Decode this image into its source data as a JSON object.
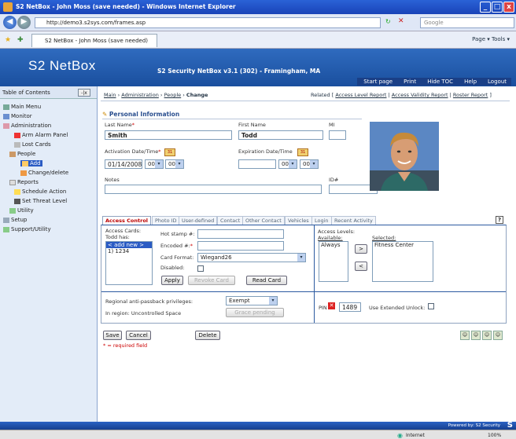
{
  "window": {
    "title": "S2 NetBox - John Moss (save needed) - Windows Internet Explorer",
    "url": "http://demo3.s2sys.com/frames.asp",
    "search_placeholder": "Google",
    "tab_title": "S2 NetBox - John Moss (save needed)",
    "ie_tools": "Page ▾  Tools ▾"
  },
  "app": {
    "logo": "S2 NetBox",
    "title": "S2 Security NetBox v3.1 (302) - Framingham, MA",
    "menu": [
      "Start page",
      "Print",
      "Hide TOC",
      "Help",
      "Logout"
    ]
  },
  "toc": {
    "header": "Table of Contents",
    "items": [
      {
        "label": "Main Menu"
      },
      {
        "label": "Monitor"
      },
      {
        "label": "Administration"
      },
      {
        "label": "Arm Alarm Panel"
      },
      {
        "label": "Lost Cards"
      },
      {
        "label": "People"
      },
      {
        "label": "Add"
      },
      {
        "label": "Change/delete"
      },
      {
        "label": "Reports"
      },
      {
        "label": "Schedule Action"
      },
      {
        "label": "Set Threat Level"
      },
      {
        "label": "Utility"
      },
      {
        "label": "Setup"
      },
      {
        "label": "Support/Utility"
      }
    ]
  },
  "breadcrumb": {
    "main": "Main",
    "admin": "Administration",
    "people": "People",
    "current": "Change"
  },
  "related": {
    "label": "Related [",
    "links": [
      "Access Level Report",
      "Access Validity Report",
      "Roster Report"
    ],
    "end": "]"
  },
  "section_title": "Personal Information",
  "form": {
    "last_name_label": "Last Name",
    "last_name": "Smith",
    "first_name_label": "First Name",
    "first_name": "Todd",
    "mi_label": "MI",
    "activation_label": "Activation Date/Time",
    "activation_date": "01/14/2008",
    "activation_hour": "00",
    "activation_min": "00",
    "expiration_label": "Expiration Date/Time",
    "expiration_hour": "00",
    "expiration_min": "00",
    "notes_label": "Notes",
    "id_label": "ID#"
  },
  "tabs": [
    "Access Control",
    "Photo ID",
    "User-defined",
    "Contact",
    "Other Contact",
    "Vehicles",
    "Login",
    "Recent Activity"
  ],
  "access": {
    "cards_label": "Access Cards:",
    "has_label": "Todd has:",
    "cards": [
      "< add new >",
      "1) 1234"
    ],
    "hotstamp_label": "Hot stamp #:",
    "encoded_label": "Encoded #:",
    "format_label": "Card Format:",
    "format": "Wiegand26",
    "disabled_label": "Disabled:",
    "apply": "Apply",
    "revoke": "Revoke Card",
    "read": "Read Card",
    "levels_label": "Access Levels:",
    "available_label": "Available:",
    "selected_label": "Selected:",
    "available": [
      "Always"
    ],
    "selected": [
      "Fitness Center"
    ],
    "add_arrow": ">",
    "remove_arrow": "<",
    "antipass_label": "Regional anti-passback privileges:",
    "antipass_value": "Exempt",
    "region_label": "In region: Uncontrolled Space",
    "grace": "Grace pending",
    "pin_label": "PIN",
    "pin": "1489",
    "ext_unlock_label": "Use Extended Unlock:"
  },
  "actions": {
    "save": "Save",
    "cancel": "Cancel",
    "delete": "Delete",
    "required_note": "* = required field"
  },
  "footer": {
    "powered": "Powered by: S2 Security",
    "status_zone": "Internet",
    "zoom": "100%"
  },
  "colors": {
    "header_blue": "#1a4f9e",
    "required_red": "#cc0000",
    "tab_active_red": "#bb0000"
  }
}
